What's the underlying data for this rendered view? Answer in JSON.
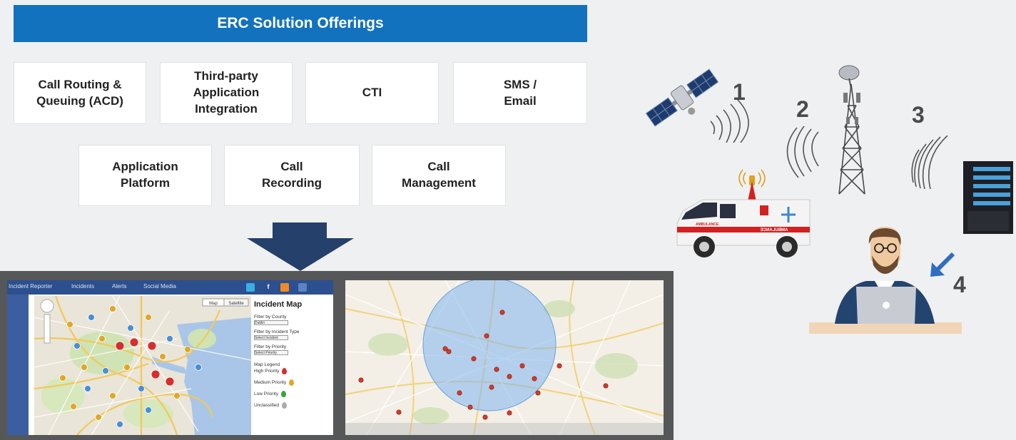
{
  "banner": {
    "title": "ERC Solution Offerings"
  },
  "offerings_row1": [
    {
      "label": "Call Routing &\nQueuing (ACD)"
    },
    {
      "label": "Third-party\nApplication\nIntegration"
    },
    {
      "label": "CTI"
    },
    {
      "label": "SMS /\nEmail"
    }
  ],
  "offerings_row2": [
    {
      "label": "Application\nPlatform"
    },
    {
      "label": "Call\nRecording"
    },
    {
      "label": "Call\nManagement"
    }
  ],
  "incident_app": {
    "nav": [
      "Incident Reporter",
      "Incidents",
      "Alerts",
      "Social Media"
    ],
    "map_buttons": [
      "Map",
      "Satellite"
    ],
    "panel_title": "Incident Map",
    "filters": [
      {
        "label": "Filter by County",
        "value": "Dublin"
      },
      {
        "label": "Filter by Incident Type",
        "value": "Select Incident"
      },
      {
        "label": "Filter by Priority",
        "value": "Select Priority"
      }
    ],
    "legend_title": "Map Legend",
    "legend": [
      {
        "label": "High Priority",
        "color": "#d62e2e"
      },
      {
        "label": "Medium Priority",
        "color": "#e0a82a"
      },
      {
        "label": "Low Priority",
        "color": "#3aa33a"
      },
      {
        "label": "Unclassified",
        "color": "#aaaaaa"
      }
    ]
  },
  "diagram_numbers": [
    "1",
    "2",
    "3",
    "4"
  ],
  "ambulance_text": "AMBULANCE",
  "colors": {
    "banner": "#1272bd",
    "arrow": "#25406b",
    "frame": "#555759"
  }
}
